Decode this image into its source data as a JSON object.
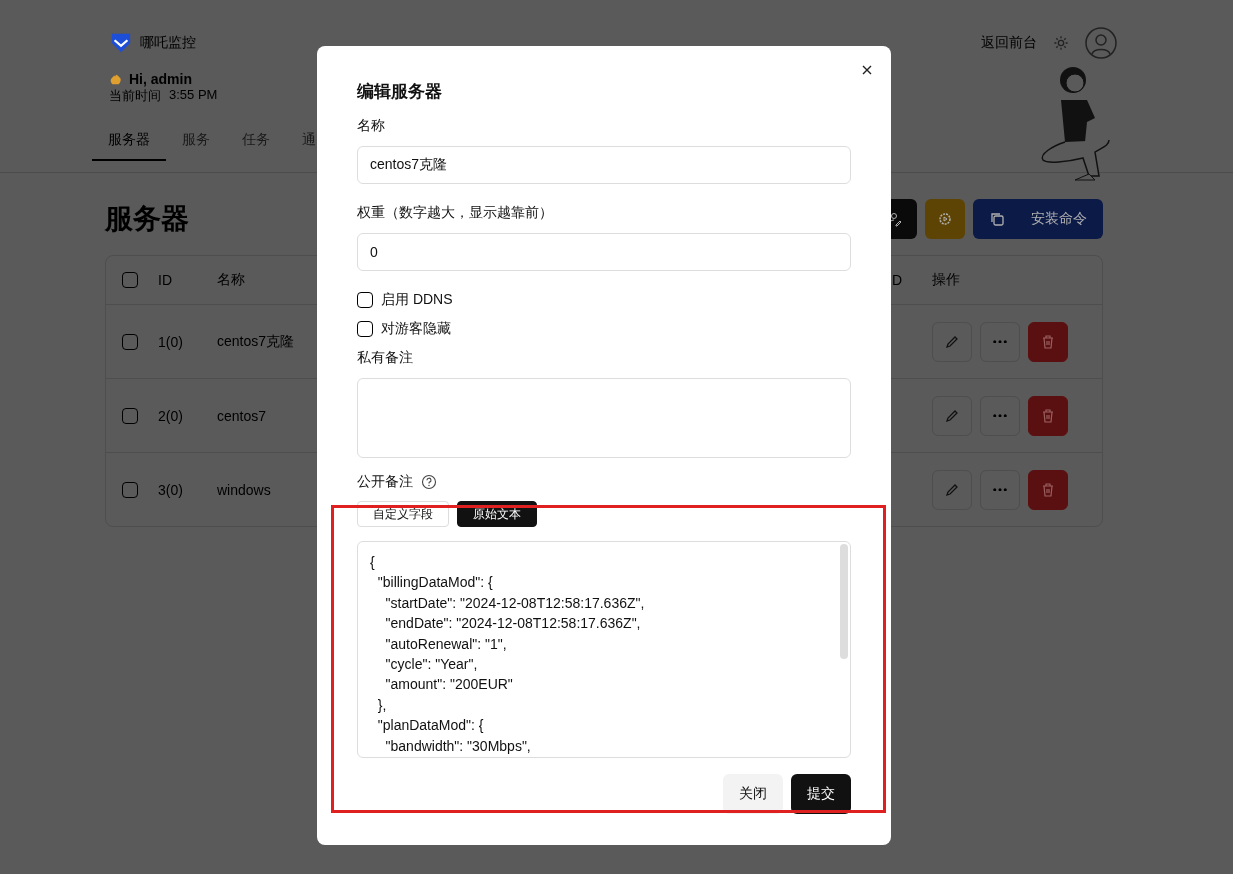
{
  "header": {
    "brand": "哪吒监控",
    "greeting": "Hi, admin",
    "time_label": "当前时间",
    "time": "3:55 PM",
    "back_link": "返回前台"
  },
  "tabs": [
    {
      "label": "服务器",
      "selected": true
    },
    {
      "label": "服务",
      "selected": false
    },
    {
      "label": "任务",
      "selected": false
    },
    {
      "label": "通",
      "selected": false
    }
  ],
  "page_title": "服务器",
  "toolbar": [
    {
      "kind": "user-edit"
    },
    {
      "kind": "gear"
    },
    {
      "kind": "copy",
      "label": "安装命令"
    }
  ],
  "table": {
    "select_all": {
      "checked": false
    },
    "columns": [
      "ID",
      "名称",
      "D",
      "操作"
    ],
    "rows": [
      {
        "checked": false,
        "id": "1(0)",
        "name": "centos7克隆"
      },
      {
        "checked": false,
        "id": "2(0)",
        "name": "centos7"
      },
      {
        "checked": false,
        "id": "3(0)",
        "name": "windows"
      }
    ]
  },
  "dialog": {
    "title": "编辑服务器",
    "fields": [
      {
        "kind": "text",
        "label": "名称",
        "value": "centos7克隆"
      },
      {
        "kind": "text",
        "label": "权重（数字越大，显示越靠前）",
        "value": "0"
      },
      {
        "kind": "checkbox",
        "label": "启用 DDNS",
        "checked": false
      },
      {
        "kind": "checkbox",
        "label": "对游客隐藏",
        "checked": false
      },
      {
        "kind": "textarea",
        "label": "私有备注"
      }
    ],
    "public_note": {
      "label": "公开备注",
      "modes": [
        {
          "label": "自定义字段",
          "selected": false
        },
        {
          "label": "原始文本",
          "selected": true
        }
      ],
      "lines": [
        "{",
        "  \"billingDataMod\": {",
        "    \"startDate\": \"2024-12-08T12:58:17.636Z\",",
        "    \"endDate\": \"2024-12-08T12:58:17.636Z\",",
        "    \"autoRenewal\": \"1\",",
        "    \"cycle\": \"Year\",",
        "    \"amount\": \"200EUR\"",
        "  },",
        "  \"planDataMod\": {",
        "    \"bandwidth\": \"30Mbps\","
      ]
    },
    "buttons": [
      {
        "kind": "secondary",
        "label": "关闭"
      },
      {
        "kind": "primary",
        "label": "提交"
      }
    ]
  },
  "annotation": {
    "kind": "box"
  }
}
